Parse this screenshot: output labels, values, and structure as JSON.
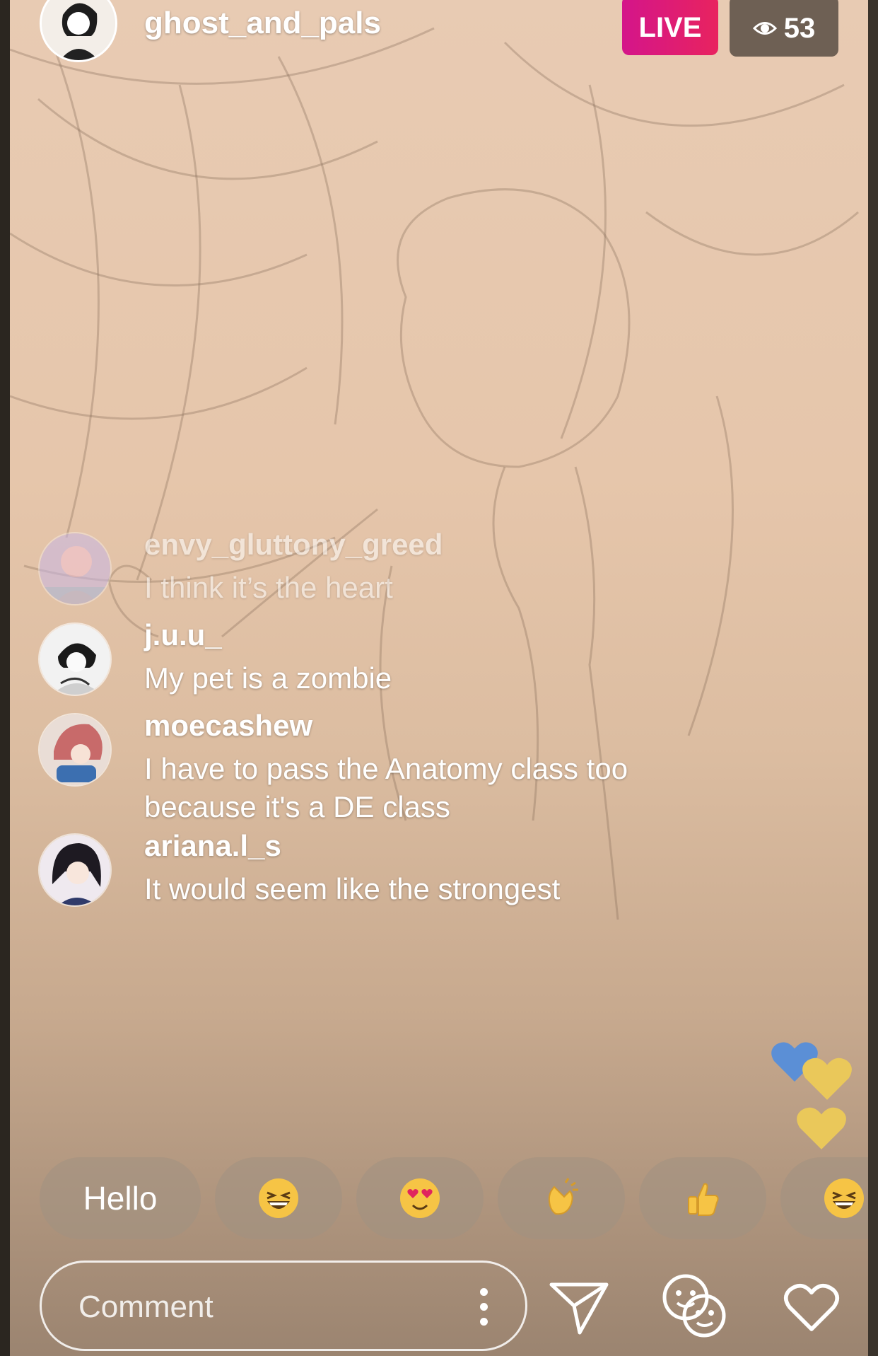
{
  "header": {
    "username": "ghost_and_pals",
    "live_label": "LIVE",
    "viewer_count": "53",
    "viewer_icon": "eye-icon"
  },
  "comments": [
    {
      "username": "envy_gluttony_greed",
      "text": "I think it’s the heart",
      "faded": true
    },
    {
      "username": "j.u.u_",
      "text": "My pet is a zombie",
      "faded": false
    },
    {
      "username": "moecashew",
      "text": "I have to pass the Anatomy class too because it's a DE class",
      "faded": false
    },
    {
      "username": "ariana.l_s",
      "text": "It would seem like the strongest",
      "faded": false
    }
  ],
  "quick_reactions": [
    {
      "label": "Hello",
      "icon": ""
    },
    {
      "label": "",
      "icon": "grinning-squinting-emoji"
    },
    {
      "label": "",
      "icon": "heart-eyes-emoji"
    },
    {
      "label": "",
      "icon": "clapping-hands-emoji"
    },
    {
      "label": "",
      "icon": "thumbs-up-emoji"
    },
    {
      "label": "",
      "icon": "grinning-squinting-emoji"
    }
  ],
  "floating_hearts": [
    {
      "color": "#5b8fd6"
    },
    {
      "color": "#eac85a"
    },
    {
      "color": "#eac85a"
    }
  ],
  "bottom_bar": {
    "comment_placeholder": "Comment",
    "icons": [
      "more-options-icon",
      "send-icon",
      "face-filter-icon",
      "heart-icon"
    ]
  },
  "colors": {
    "live_gradient_start": "#d4158a",
    "live_gradient_end": "#e8235f",
    "reaction_yellow": "#f6c445"
  }
}
